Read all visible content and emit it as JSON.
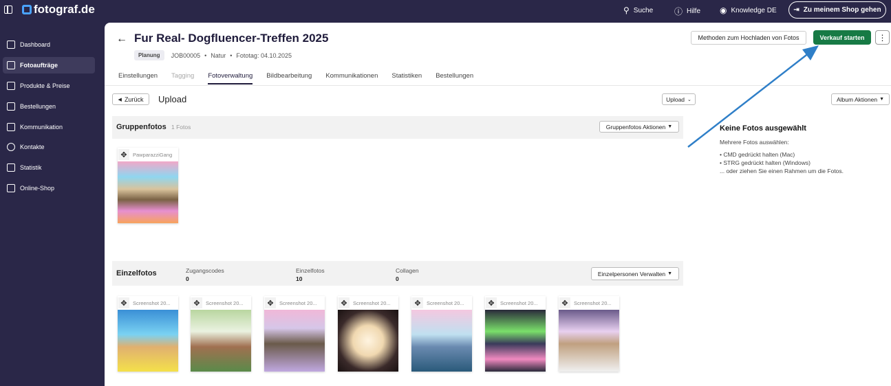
{
  "topbar": {
    "brand": "fotograf.de",
    "nav": [
      {
        "label": "Suche",
        "icon": "search-icon"
      },
      {
        "label": "Hilfe",
        "icon": "info-icon"
      },
      {
        "label": "Knowledge DE",
        "icon": "user-icon"
      }
    ],
    "shop_button": "Zu meinem Shop gehen"
  },
  "sidebar": {
    "items": [
      {
        "label": "Dashboard",
        "icon": "home-icon"
      },
      {
        "label": "Fotoaufträge",
        "icon": "image-icon",
        "active": true
      },
      {
        "label": "Produkte & Preise",
        "icon": "cart-icon"
      },
      {
        "label": "Bestellungen",
        "icon": "box-icon"
      },
      {
        "label": "Kommunikation",
        "icon": "chat-icon"
      },
      {
        "label": "Kontakte",
        "icon": "person-icon"
      },
      {
        "label": "Statistik",
        "icon": "chart-icon"
      },
      {
        "label": "Online-Shop",
        "icon": "store-icon"
      }
    ]
  },
  "header": {
    "title": "Fur Real- Dogfluencer-Treffen 2025",
    "status_badge": "Planung",
    "job_id": "JOB00005",
    "category": "Natur",
    "shoot_date": "Fototag: 04.10.2025",
    "upload_methods_button": "Methoden zum Hochladen von Fotos",
    "start_sale_button": "Verkauf starten",
    "more_button": "⋮"
  },
  "tabs": [
    {
      "label": "Einstellungen",
      "state": "normal"
    },
    {
      "label": "Tagging",
      "state": "disabled"
    },
    {
      "label": "Fotoverwaltung",
      "state": "active"
    },
    {
      "label": "Bildbearbeitung",
      "state": "normal"
    },
    {
      "label": "Kommunikationen",
      "state": "normal"
    },
    {
      "label": "Statistiken",
      "state": "normal"
    },
    {
      "label": "Bestellungen",
      "state": "normal"
    }
  ],
  "toolbar": {
    "back_button": "Zurück",
    "current_album": "Upload",
    "upload_dropdown": "Upload",
    "album_actions": "Album Aktionen"
  },
  "group_section": {
    "title": "Gruppenfotos",
    "count": "1 Fotos",
    "actions": "Gruppenfotos Aktionen",
    "photos": [
      {
        "name": "PawparazziGang"
      }
    ]
  },
  "single_section": {
    "title": "Einzelfotos",
    "stats": [
      {
        "label": "Zugangscodes",
        "value": "0"
      },
      {
        "label": "Einzelfotos",
        "value": "10"
      },
      {
        "label": "Collagen",
        "value": "0"
      }
    ],
    "actions": "Einzelpersonen Verwalten",
    "photos": [
      {
        "name": "Screenshot 20..."
      },
      {
        "name": "Screenshot 20..."
      },
      {
        "name": "Screenshot 20..."
      },
      {
        "name": "Screenshot 20..."
      },
      {
        "name": "Screenshot 20..."
      },
      {
        "name": "Screenshot 20..."
      },
      {
        "name": "Screenshot 20..."
      }
    ]
  },
  "selection_panel": {
    "heading": "Keine Fotos ausgewählt",
    "intro": "Mehrere Fotos auswählen:",
    "hint_mac": "• CMD gedrückt halten (Mac)",
    "hint_win": "• STRG gedrückt halten (Windows)",
    "hint_drag": "... oder ziehen Sie einen Rahmen um die Fotos."
  },
  "colors": {
    "sidebar_bg": "#2a2748",
    "primary_green": "#177a45",
    "annotation_arrow": "#2f7fc8",
    "brand_accent": "#4aa3ff"
  }
}
